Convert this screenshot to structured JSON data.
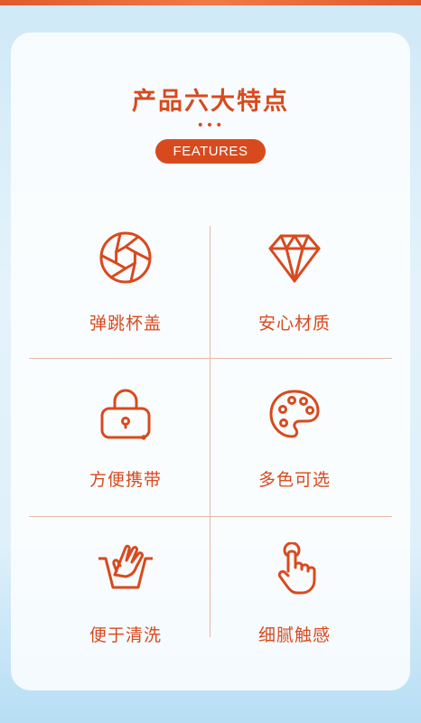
{
  "header": {
    "title": "产品六大特点",
    "dots": "•••",
    "badge": "FEATURES"
  },
  "colors": {
    "accent": "#d84a1e",
    "divider": "#e7b8a6"
  },
  "features": [
    {
      "label": "弹跳杯盖",
      "icon": "aperture-icon"
    },
    {
      "label": "安心材质",
      "icon": "diamond-icon"
    },
    {
      "label": "方便携带",
      "icon": "bag-icon"
    },
    {
      "label": "多色可选",
      "icon": "palette-icon"
    },
    {
      "label": "便于清洗",
      "icon": "hand-wash-icon"
    },
    {
      "label": "细腻触感",
      "icon": "touch-icon"
    }
  ]
}
